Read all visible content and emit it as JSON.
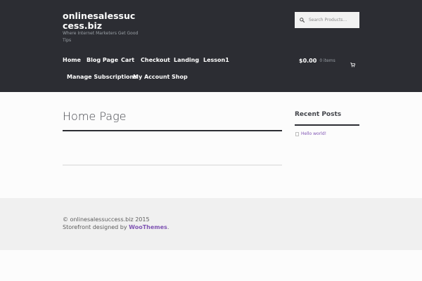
{
  "site": {
    "title": "onlinesalessuccess.biz",
    "description": "Where Internet Marketers Get Good Tips"
  },
  "search": {
    "placeholder": "Search Products…",
    "icon": "search-icon"
  },
  "nav": {
    "items": [
      {
        "label": "Home"
      },
      {
        "label": "Blog Page"
      },
      {
        "label": "Cart"
      },
      {
        "label": "Checkout"
      },
      {
        "label": "Landing"
      },
      {
        "label": "Lesson1"
      },
      {
        "label": "Manage Subscriptions"
      },
      {
        "label": "My Account"
      },
      {
        "label": "Shop"
      }
    ]
  },
  "cart": {
    "amount": "$0.00",
    "items": "0 items",
    "icon": "cart-icon"
  },
  "main": {
    "page_title": "Home Page"
  },
  "sidebar": {
    "widget_title": "Recent Posts",
    "posts": [
      {
        "label": "Hello world!"
      }
    ]
  },
  "footer": {
    "copyright": "© onlinesalessuccess.biz 2015",
    "designed_by_prefix": "Storefront designed by",
    "designed_by_link": "WooThemes",
    "designed_by_suffix": "."
  },
  "colors": {
    "header_bg": "#2c2d33",
    "accent": "#7f54b3",
    "body_bg": "#fcfcfc",
    "footer_bg": "#f0f0f0"
  }
}
